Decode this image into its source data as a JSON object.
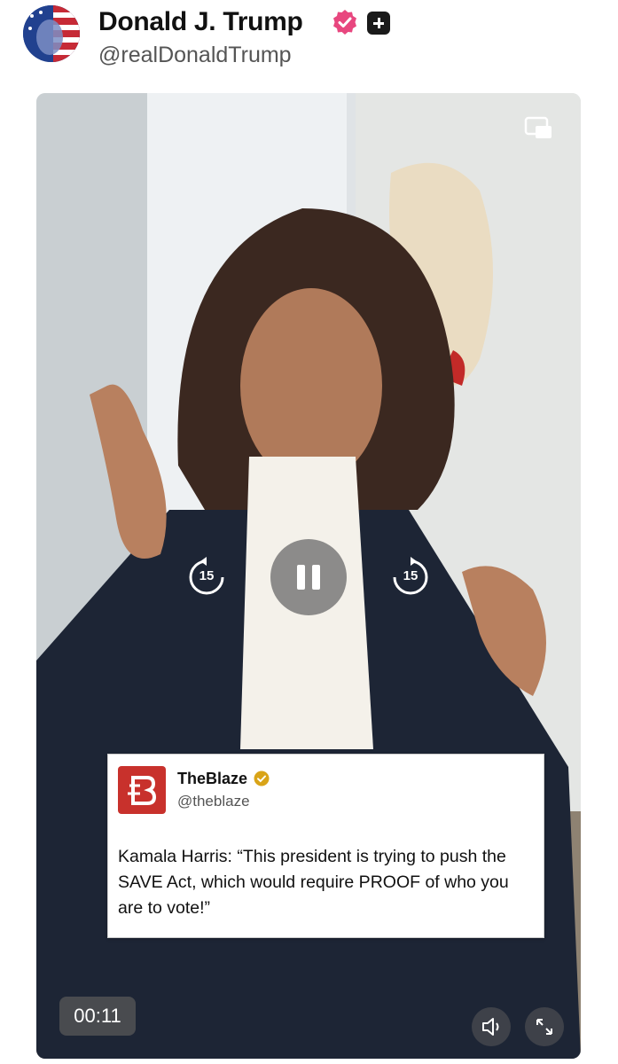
{
  "post": {
    "author": {
      "display_name": "Donald J. Trump",
      "handle": "@realDonaldTrump",
      "verified_icon": "verified-badge-icon",
      "verified_color": "#e8477f",
      "follow_icon": "plus-icon"
    }
  },
  "video": {
    "timestamp": "00:11",
    "skip_back_seconds": "15",
    "skip_forward_seconds": "15",
    "state": "playing",
    "controls": {
      "pip_icon": "picture-in-picture-icon",
      "pause_icon": "pause-icon",
      "mute_icon": "speaker-icon",
      "fullscreen_icon": "expand-icon"
    },
    "overlay_card": {
      "name": "TheBlaze",
      "handle": "@theblaze",
      "text": "Kamala Harris: “This president is trying to push the SAVE Act, which would require PROOF of who you are to vote!”",
      "logo_color": "#c8312c",
      "verified_color": "#d9a418"
    }
  }
}
